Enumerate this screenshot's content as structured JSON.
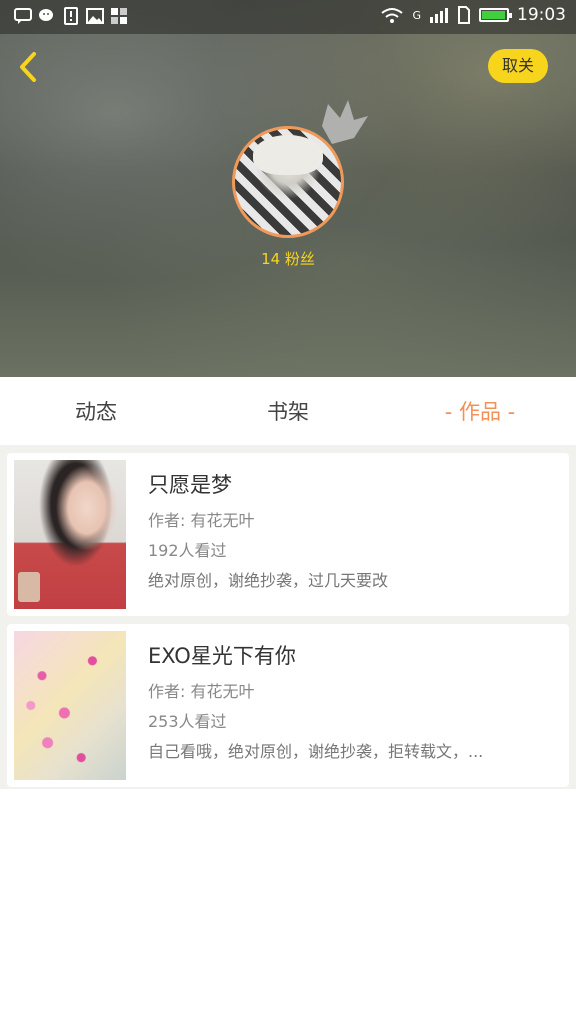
{
  "status_bar": {
    "time": "19:03",
    "network": "G",
    "battery_level": 0.95,
    "left_icons": [
      "message-icon",
      "wechat-icon",
      "alert-icon",
      "image-icon",
      "apps-icon"
    ],
    "colors": {
      "battery": "#3fcf3f"
    }
  },
  "header": {
    "back_icon": "chevron-left-icon",
    "unfollow_label": "取关",
    "fans_text": "14 粉丝",
    "avatar_ring_color": "#f09a5a",
    "accent_yellow": "#f7d51d"
  },
  "tabs": [
    {
      "label": "动态",
      "active": false
    },
    {
      "label": "书架",
      "active": false
    },
    {
      "label": "- 作品 -",
      "active": true
    }
  ],
  "accent_color": "#f2905a",
  "works": [
    {
      "title": "只愿是梦",
      "author": "作者: 有花无叶",
      "views": "192人看过",
      "desc": "绝对原创，谢绝抄袭，过几天要改"
    },
    {
      "title": "EXO星光下有你",
      "author": "作者: 有花无叶",
      "views": "253人看过",
      "desc": "自己看哦，绝对原创，谢绝抄袭，拒转载文，..."
    }
  ]
}
